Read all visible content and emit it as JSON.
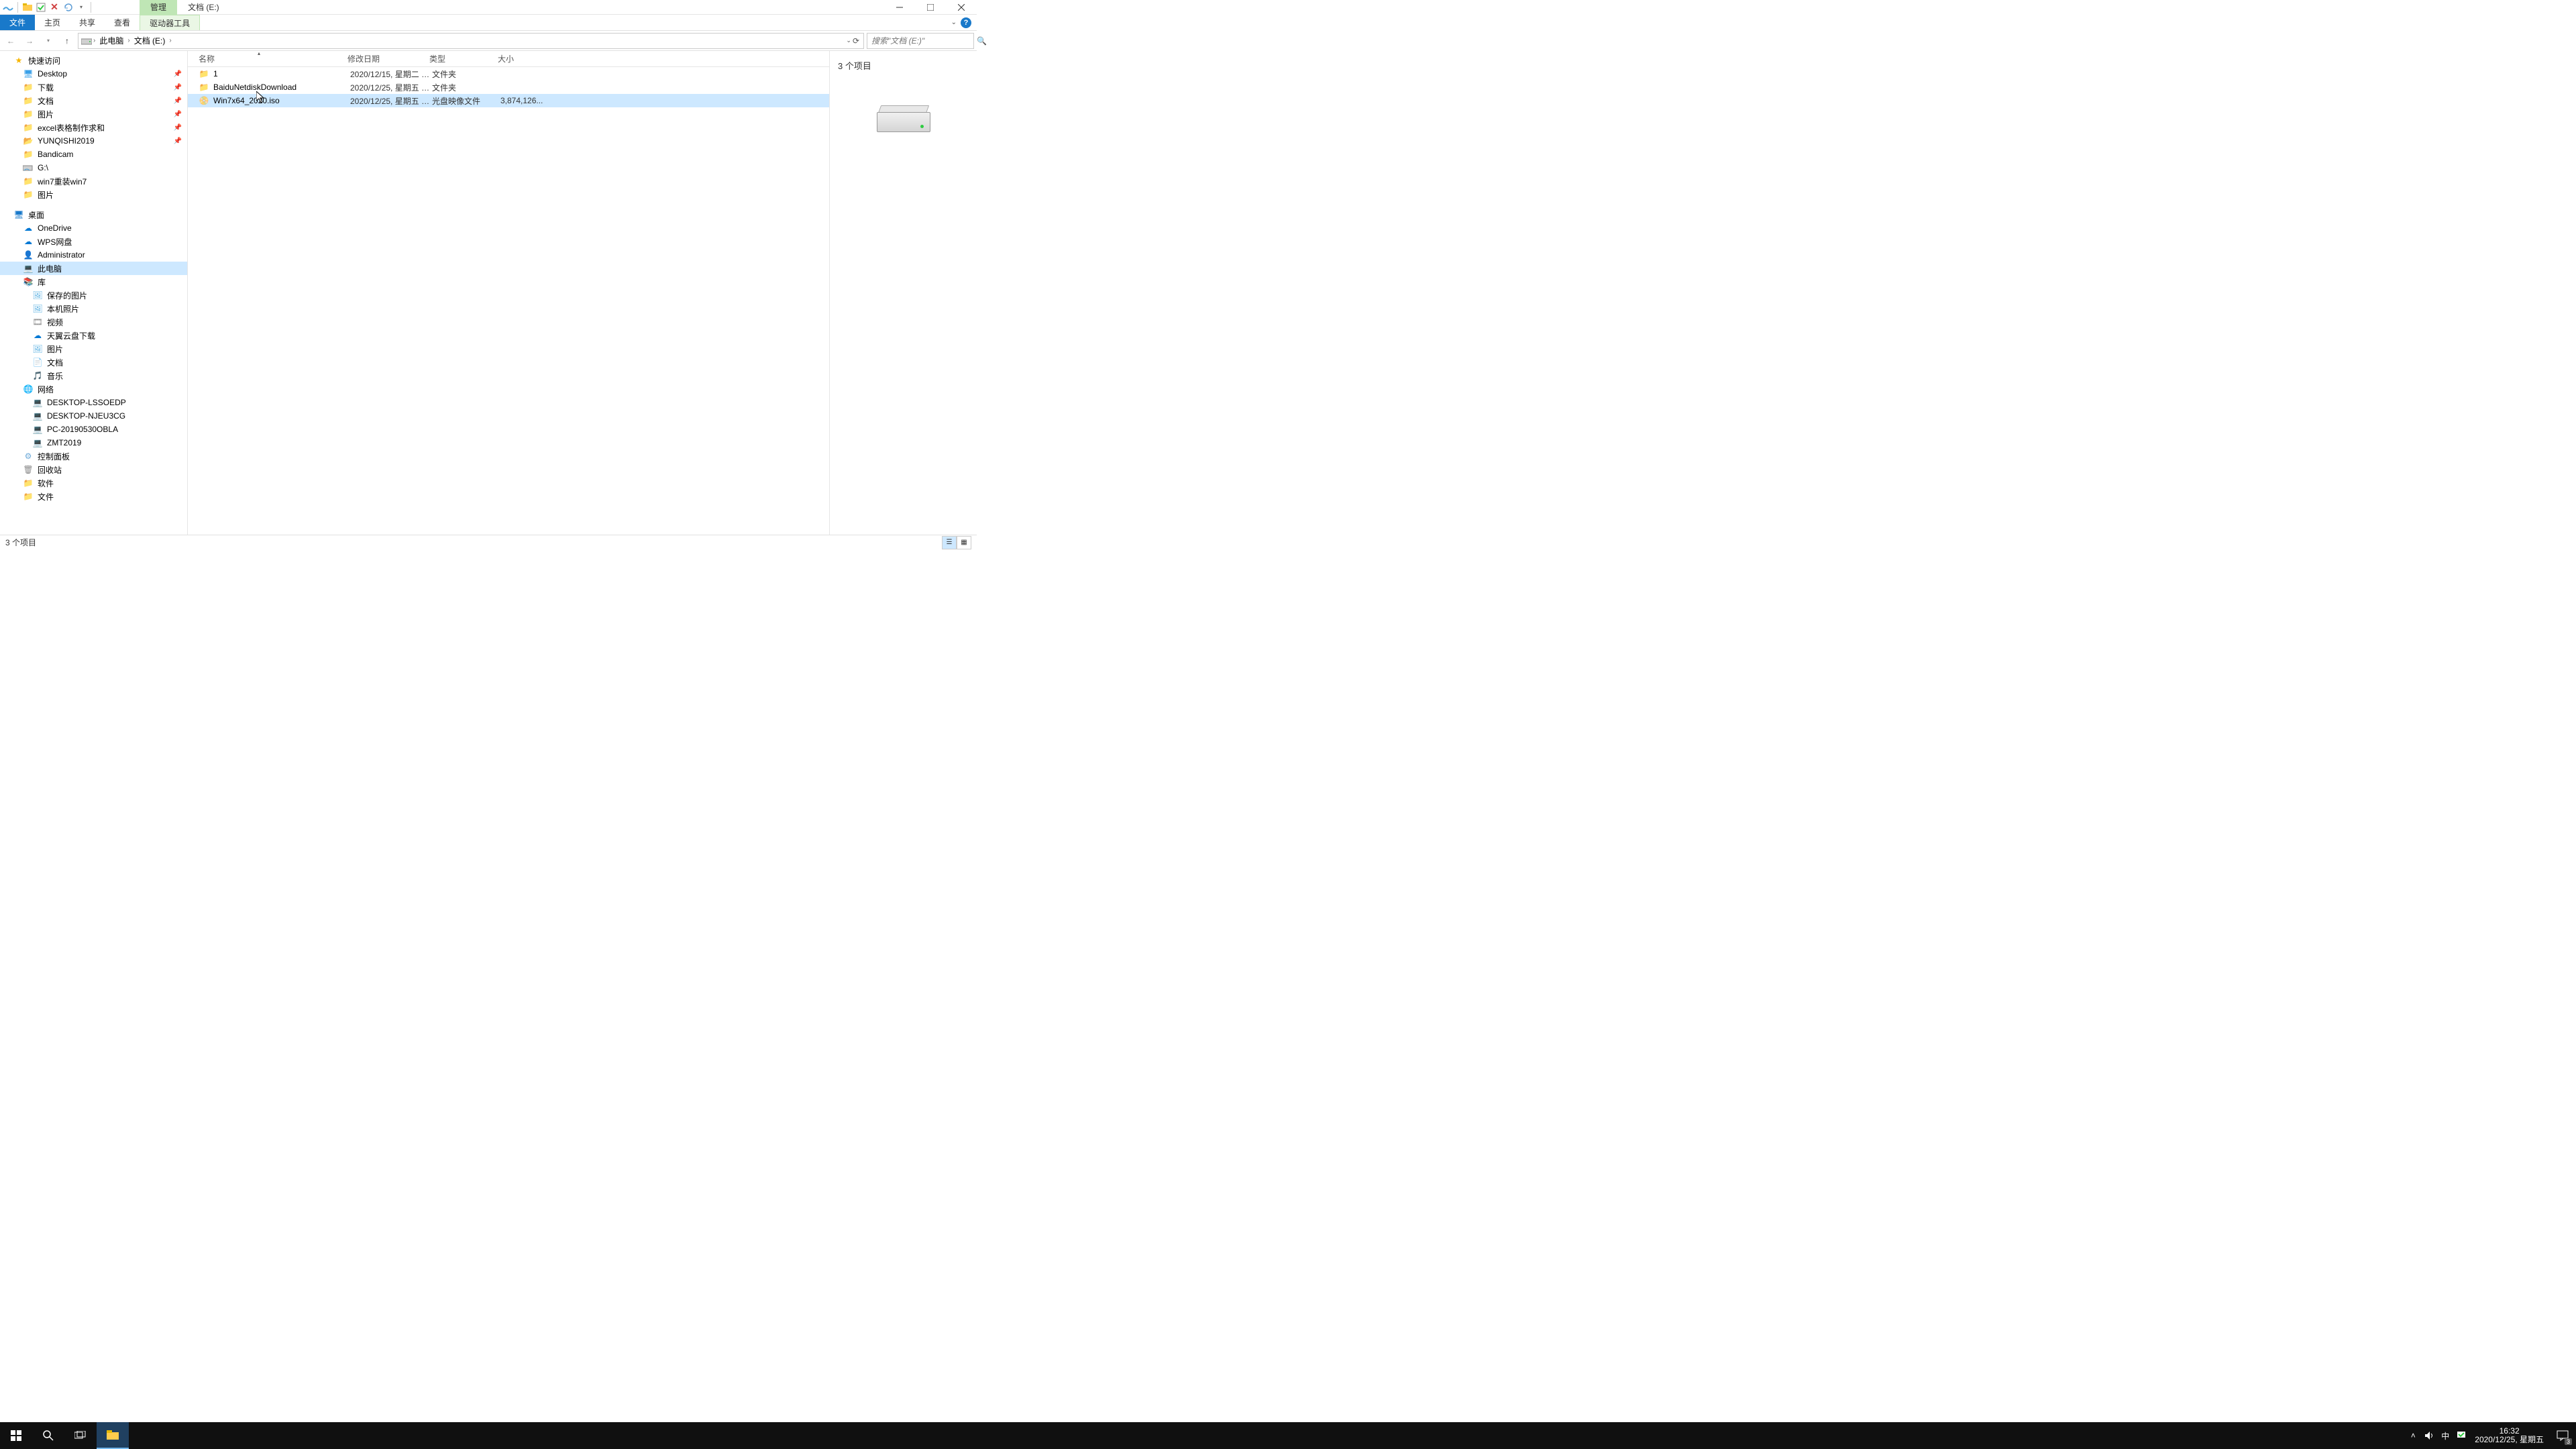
{
  "title": {
    "context_tab": "管理",
    "window_title": "文档 (E:)"
  },
  "ribbon": {
    "file": "文件",
    "tabs": [
      "主页",
      "共享",
      "查看"
    ],
    "context": "驱动器工具"
  },
  "breadcrumb": {
    "items": [
      "此电脑",
      "文档 (E:)"
    ]
  },
  "search": {
    "placeholder": "搜索\"文档 (E:)\""
  },
  "nav": {
    "quick_access": "快速访问",
    "pinned": [
      {
        "label": "Desktop",
        "icon": "desktop"
      },
      {
        "label": "下载",
        "icon": "folder"
      },
      {
        "label": "文档",
        "icon": "folder"
      },
      {
        "label": "图片",
        "icon": "folder"
      },
      {
        "label": "excel表格制作求和",
        "icon": "folder"
      },
      {
        "label": "YUNQISHI2019",
        "icon": "folder-open"
      },
      {
        "label": "Bandicam",
        "icon": "folder"
      },
      {
        "label": "G:\\",
        "icon": "drive-link"
      },
      {
        "label": "win7重装win7",
        "icon": "folder"
      },
      {
        "label": "图片",
        "icon": "folder"
      }
    ],
    "desktop": "桌面",
    "desktop_items": [
      {
        "label": "OneDrive",
        "icon": "cloud"
      },
      {
        "label": "WPS网盘",
        "icon": "cloud"
      },
      {
        "label": "Administrator",
        "icon": "user"
      },
      {
        "label": "此电脑",
        "icon": "computer",
        "selected": true
      },
      {
        "label": "库",
        "icon": "library"
      }
    ],
    "library_items": [
      {
        "label": "保存的图片"
      },
      {
        "label": "本机照片"
      },
      {
        "label": "视频"
      },
      {
        "label": "天翼云盘下载"
      },
      {
        "label": "图片"
      },
      {
        "label": "文档"
      },
      {
        "label": "音乐"
      }
    ],
    "network": "网络",
    "network_items": [
      {
        "label": "DESKTOP-LSSOEDP"
      },
      {
        "label": "DESKTOP-NJEU3CG"
      },
      {
        "label": "PC-20190530OBLA"
      },
      {
        "label": "ZMT2019"
      }
    ],
    "bottom_items": [
      {
        "label": "控制面板",
        "icon": "control-panel"
      },
      {
        "label": "回收站",
        "icon": "recycle"
      },
      {
        "label": "软件",
        "icon": "folder"
      },
      {
        "label": "文件",
        "icon": "folder"
      }
    ]
  },
  "columns": {
    "name": "名称",
    "date": "修改日期",
    "type": "类型",
    "size": "大小"
  },
  "files": [
    {
      "name": "1",
      "date": "2020/12/15, 星期二 1...",
      "type": "文件夹",
      "size": "",
      "icon": "folder",
      "selected": false
    },
    {
      "name": "BaiduNetdiskDownload",
      "date": "2020/12/25, 星期五 1...",
      "type": "文件夹",
      "size": "",
      "icon": "folder",
      "selected": false
    },
    {
      "name": "Win7x64_2020.iso",
      "date": "2020/12/25, 星期五 1...",
      "type": "光盘映像文件",
      "size": "3,874,126...",
      "icon": "iso",
      "selected": true
    }
  ],
  "preview": {
    "title": "3 个项目"
  },
  "status": {
    "text": "3 个项目"
  },
  "taskbar": {
    "time": "16:32",
    "date": "2020/12/25, 星期五",
    "ime": "中",
    "notif_count": "3"
  }
}
